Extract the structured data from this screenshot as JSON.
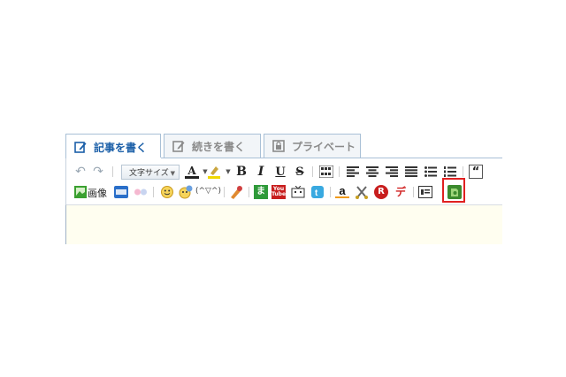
{
  "tabs": [
    {
      "label": "記事を書く",
      "icon": "pencil-icon",
      "active": true
    },
    {
      "label": "続きを書く",
      "icon": "pencil-icon",
      "active": false
    },
    {
      "label": "プライベート",
      "icon": "lock-icon",
      "active": false
    }
  ],
  "toolbar": {
    "font_size_label": "文字サイズ",
    "image_label": "画像",
    "emoticon_label": "(^▽^)",
    "row1_icons": [
      "undo-icon",
      "redo-icon",
      "font-color-icon",
      "highlight-color-icon",
      "bold-icon",
      "italic-icon",
      "underline-icon",
      "strikethrough-icon",
      "special-chars-icon",
      "align-left-icon",
      "align-center-icon",
      "align-right-icon",
      "justify-icon",
      "bullet-list-icon",
      "numbered-list-icon",
      "blockquote-icon"
    ],
    "glyphs": {
      "undo": "↶",
      "redo": "↷",
      "font_color": "A",
      "bold": "B",
      "italic": "I",
      "underline": "U",
      "strike": "S",
      "quote": "“"
    },
    "row2_icons": [
      "image-icon",
      "photozou-icon",
      "flickr-icon",
      "emoji-icon",
      "emoji-palette-icon",
      "kaomoji-icon",
      "decoration-icon",
      "map-icon",
      "youtube-icon",
      "niconico-icon",
      "twitter-icon",
      "amazon-icon",
      "cut-icon",
      "rakuten-icon",
      "dekomail-icon",
      "embed-icon",
      "evernote-icon"
    ],
    "badges": {
      "map": "ま",
      "youtube": "You\nTube",
      "amazon": "a",
      "rakuten": "R",
      "de": "デ"
    }
  },
  "colors": {
    "tab_border": "#a9c0d6",
    "active_tab_text": "#1b5fa8",
    "content_bg": "#fffef0",
    "highlight_border": "#e02020"
  }
}
